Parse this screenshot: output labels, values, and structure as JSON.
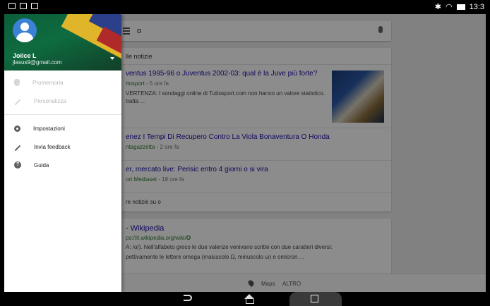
{
  "status": {
    "time": "13:3"
  },
  "search": {
    "query": "o"
  },
  "news_card": {
    "header": "lle notizie",
    "items": [
      {
        "title": "ventus 1995-96 o Juventus 2002-03: qual è la Juve più forte?",
        "source": "ttosport",
        "age": " - 5 ore fa",
        "snippet": "VERTENZA: I sondaggi online di Tuttosport.com non hanno un valore statistico. tratta ..."
      },
      {
        "title": "enez I Tempi Di Recupero Contro La Viola Bonaventura O Honda",
        "source": "ntagazzetta",
        "age": " - 2 ore fa",
        "snippet": ""
      },
      {
        "title": "er, mercato live: Perisic entro 4 giorni o si vira",
        "source": "ort Mediaset",
        "age": " - 18 ore fa",
        "snippet": ""
      }
    ],
    "more": "re notizie su o"
  },
  "wiki_card": {
    "title": "- Wikipedia",
    "url_prefix": "ps://it.wikipedia.org/wiki/",
    "url_bold": "O",
    "line1": "A: /o/). Nell'alfabeto greco le due valenze venivano scritte con due caratteri diversi:",
    "line2": "pettivamente le lettere omega (maiuscolo Ω, minuscolo ω) e omicron ..."
  },
  "bottom_tabs": {
    "maps": "Maps",
    "altro": "ALTRO"
  },
  "drawer": {
    "user_name": "Joiice L",
    "user_email": "jlasus9@gmail.com",
    "items_disabled": [
      {
        "label": "Promemoria",
        "icon": "hand-icon"
      },
      {
        "label": "Personalizza",
        "icon": "magic-wand-icon"
      }
    ],
    "items": [
      {
        "label": "Impostazioni",
        "icon": "gear-icon"
      },
      {
        "label": "Invia feedback",
        "icon": "pencil-icon"
      },
      {
        "label": "Guida",
        "icon": "help-icon"
      }
    ]
  },
  "colors": {
    "drawer_header": "#0e6b40",
    "avatar": "#3b82d6",
    "link": "#1a0dab",
    "source": "#2e7d32"
  }
}
